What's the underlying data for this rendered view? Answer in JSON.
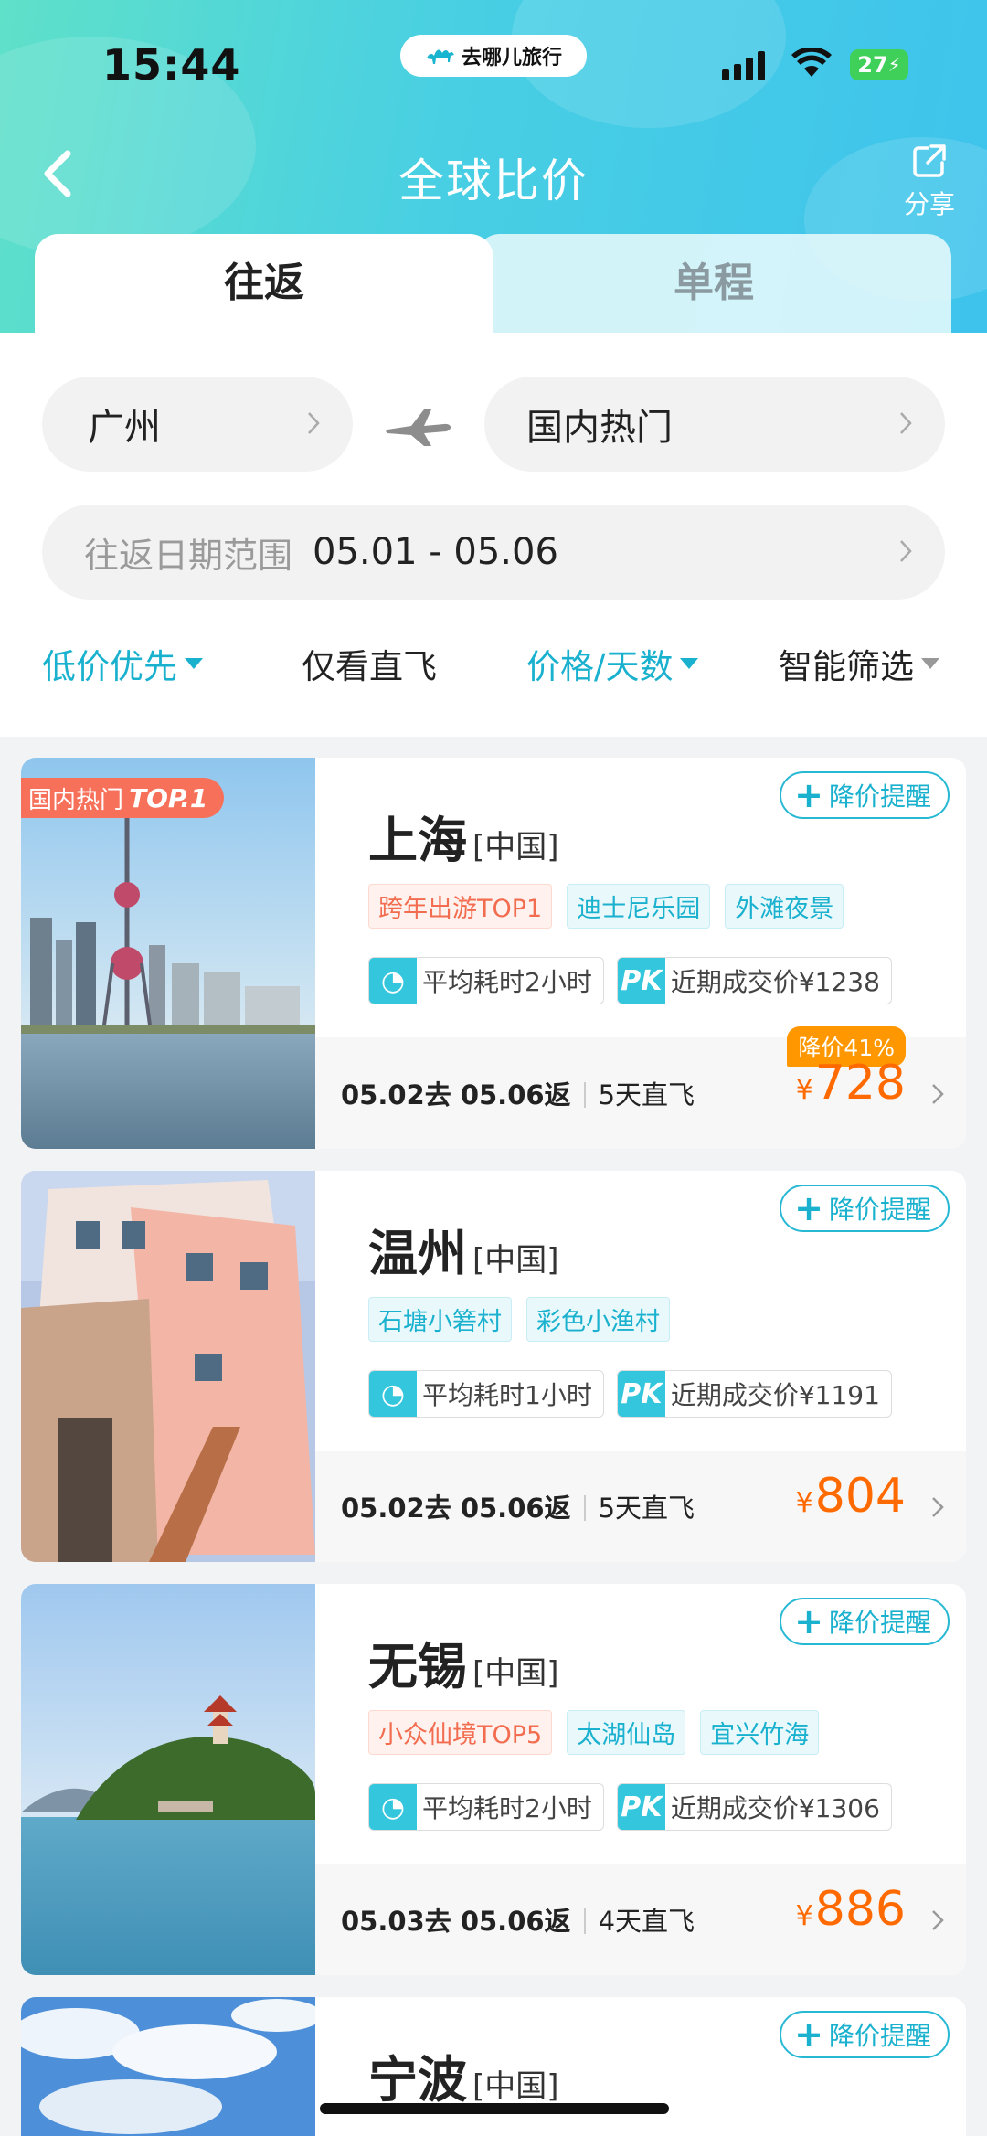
{
  "status_bar": {
    "time": "15:44",
    "app_badge": "去哪儿旅行",
    "battery": "27"
  },
  "nav": {
    "title": "全球比价",
    "share_label": "分享"
  },
  "tabs": [
    {
      "label": "往返",
      "active": true
    },
    {
      "label": "单程",
      "active": false
    }
  ],
  "search": {
    "origin": "广州",
    "destination": "国内热门",
    "date_label": "往返日期范围",
    "date_value": "05.01 - 05.06"
  },
  "filters": [
    {
      "label": "低价优先",
      "active": true,
      "dropdown": true
    },
    {
      "label": "仅看直飞",
      "active": false,
      "dropdown": false
    },
    {
      "label": "价格/天数",
      "active": true,
      "dropdown": true
    },
    {
      "label": "智能筛选",
      "active": false,
      "dropdown": true
    }
  ],
  "cards": [
    {
      "city": "上海",
      "country": "[中国]",
      "top_badge": {
        "prefix": "国内热门",
        "rank": "TOP.1"
      },
      "alert_label": "降价提醒",
      "tags": [
        {
          "text": "跨年出游TOP1",
          "style": "red"
        },
        {
          "text": "迪士尼乐园",
          "style": "blue"
        },
        {
          "text": "外滩夜景",
          "style": "blue"
        }
      ],
      "avg_time": "平均耗时2小时",
      "recent_price": "近期成交价¥1238",
      "dates": "05.02去 05.06返",
      "days": "5天直飞",
      "price_symbol": "¥",
      "price": "728",
      "discount": "降价41%"
    },
    {
      "city": "温州",
      "country": "[中国]",
      "alert_label": "降价提醒",
      "tags": [
        {
          "text": "石塘小箬村",
          "style": "blue"
        },
        {
          "text": "彩色小渔村",
          "style": "blue"
        }
      ],
      "avg_time": "平均耗时1小时",
      "recent_price": "近期成交价¥1191",
      "dates": "05.02去 05.06返",
      "days": "5天直飞",
      "price_symbol": "¥",
      "price": "804"
    },
    {
      "city": "无锡",
      "country": "[中国]",
      "alert_label": "降价提醒",
      "tags": [
        {
          "text": "小众仙境TOP5",
          "style": "red"
        },
        {
          "text": "太湖仙岛",
          "style": "blue"
        },
        {
          "text": "宜兴竹海",
          "style": "blue"
        }
      ],
      "avg_time": "平均耗时2小时",
      "recent_price": "近期成交价¥1306",
      "dates": "05.03去 05.06返",
      "days": "4天直飞",
      "price_symbol": "¥",
      "price": "886"
    },
    {
      "city": "宁波",
      "country": "[中国]",
      "alert_label": "降价提醒"
    }
  ],
  "colors": {
    "accent": "#1ab1cf",
    "price": "#ff6a00",
    "discount_badge": "#ff9800",
    "header_start": "#5fe0c9",
    "header_end": "#3ec3ec"
  }
}
